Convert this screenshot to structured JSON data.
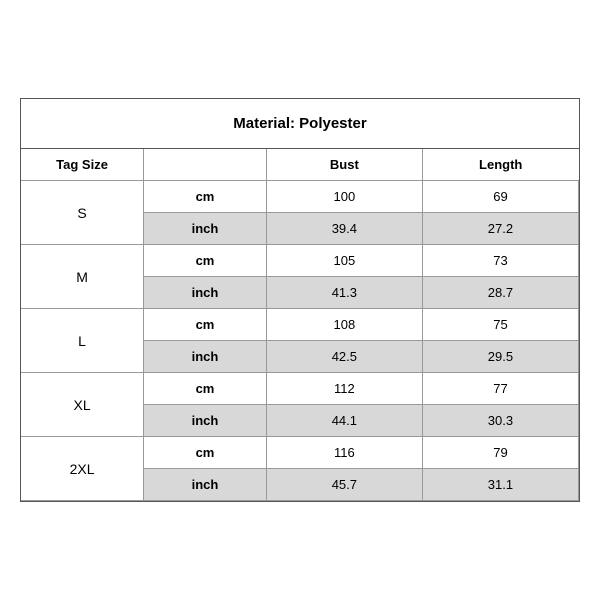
{
  "title": "Material: Polyester",
  "headers": {
    "tag_size": "Tag Size",
    "bust": "Bust",
    "length": "Length"
  },
  "rows": [
    {
      "size": "S",
      "cm": {
        "bust": "100",
        "length": "69"
      },
      "inch": {
        "bust": "39.4",
        "length": "27.2"
      }
    },
    {
      "size": "M",
      "cm": {
        "bust": "105",
        "length": "73"
      },
      "inch": {
        "bust": "41.3",
        "length": "28.7"
      }
    },
    {
      "size": "L",
      "cm": {
        "bust": "108",
        "length": "75"
      },
      "inch": {
        "bust": "42.5",
        "length": "29.5"
      }
    },
    {
      "size": "XL",
      "cm": {
        "bust": "112",
        "length": "77"
      },
      "inch": {
        "bust": "44.1",
        "length": "30.3"
      }
    },
    {
      "size": "2XL",
      "cm": {
        "bust": "116",
        "length": "79"
      },
      "inch": {
        "bust": "45.7",
        "length": "31.1"
      }
    }
  ],
  "unit_labels": {
    "cm": "cm",
    "inch": "inch"
  }
}
